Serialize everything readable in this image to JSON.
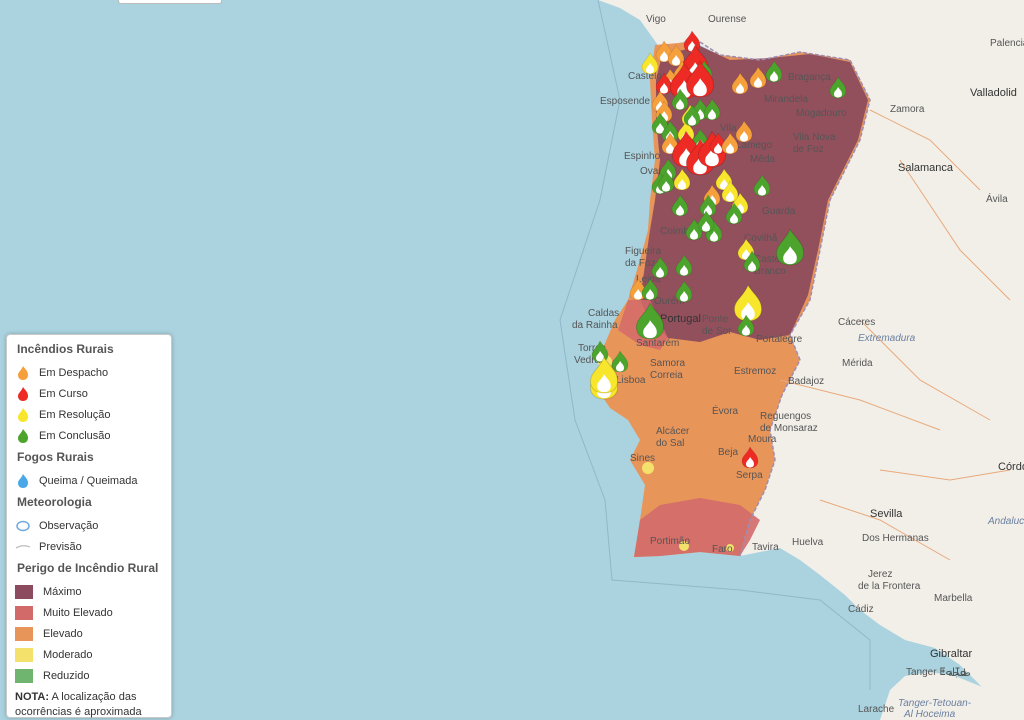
{
  "colors": {
    "sea": "#aad3df",
    "land": "#f2efe9",
    "danger_max": "#8b4a5e",
    "danger_very_high": "#d36a6a",
    "danger_high": "#e8955a",
    "danger_moderate": "#f3e16b",
    "danger_low": "#6fb56f",
    "fire_dispatch": "#f6a03c",
    "fire_ongoing": "#ee2a24",
    "fire_resolution": "#f7e62b",
    "fire_conclusion": "#4ca42c",
    "burn": "#4aa8e8"
  },
  "places": [
    {
      "name": "Vigo",
      "cls": ""
    },
    {
      "name": "Ourense",
      "cls": ""
    },
    {
      "name": "Palencia",
      "cls": ""
    },
    {
      "name": "Valladolid",
      "cls": "big"
    },
    {
      "name": "Zamora",
      "cls": ""
    },
    {
      "name": "Bragança",
      "cls": ""
    },
    {
      "name": "Mirandela",
      "cls": ""
    },
    {
      "name": "Mogadouro",
      "cls": ""
    },
    {
      "name": "Esposende",
      "cls": ""
    },
    {
      "name": "Castelo",
      "cls": ""
    },
    {
      "name": "Vila",
      "cls": ""
    },
    {
      "name": "Lamego",
      "cls": ""
    },
    {
      "name": "Vila Nova",
      "cls": ""
    },
    {
      "name": "de Foz",
      "cls": ""
    },
    {
      "name": "Salamanca",
      "cls": "big"
    },
    {
      "name": "Espinho",
      "cls": ""
    },
    {
      "name": "Ovar",
      "cls": ""
    },
    {
      "name": "Mêda",
      "cls": ""
    },
    {
      "name": "Ávila",
      "cls": ""
    },
    {
      "name": "Guarda",
      "cls": ""
    },
    {
      "name": "Coimbra",
      "cls": ""
    },
    {
      "name": "Figueira",
      "cls": ""
    },
    {
      "name": "da Foz",
      "cls": ""
    },
    {
      "name": "Covilhã",
      "cls": ""
    },
    {
      "name": "Castelo",
      "cls": ""
    },
    {
      "name": "Branco",
      "cls": ""
    },
    {
      "name": "Leiria",
      "cls": ""
    },
    {
      "name": "Ourém",
      "cls": ""
    },
    {
      "name": "Caldas",
      "cls": ""
    },
    {
      "name": "da Rainha",
      "cls": ""
    },
    {
      "name": "Portugal",
      "cls": "big"
    },
    {
      "name": "Ponte",
      "cls": ""
    },
    {
      "name": "de Sor",
      "cls": ""
    },
    {
      "name": "Cáceres",
      "cls": ""
    },
    {
      "name": "Portalegre",
      "cls": ""
    },
    {
      "name": "Extremadura",
      "cls": "it"
    },
    {
      "name": "Santarém",
      "cls": ""
    },
    {
      "name": "Torres",
      "cls": ""
    },
    {
      "name": "Vedras",
      "cls": ""
    },
    {
      "name": "Mérida",
      "cls": ""
    },
    {
      "name": "Samora",
      "cls": ""
    },
    {
      "name": "Correia",
      "cls": ""
    },
    {
      "name": "Estremoz",
      "cls": ""
    },
    {
      "name": "Lisboa",
      "cls": ""
    },
    {
      "name": "Badajoz",
      "cls": ""
    },
    {
      "name": "Évora",
      "cls": ""
    },
    {
      "name": "Reguengos",
      "cls": ""
    },
    {
      "name": "de Monsaraz",
      "cls": ""
    },
    {
      "name": "Alcácer",
      "cls": ""
    },
    {
      "name": "do Sal",
      "cls": ""
    },
    {
      "name": "Moura",
      "cls": ""
    },
    {
      "name": "Sines",
      "cls": ""
    },
    {
      "name": "Beja",
      "cls": ""
    },
    {
      "name": "Serpa",
      "cls": ""
    },
    {
      "name": "Córdoba",
      "cls": "big"
    },
    {
      "name": "Andalucía",
      "cls": "it"
    },
    {
      "name": "Sevilla",
      "cls": "big"
    },
    {
      "name": "Portimão",
      "cls": ""
    },
    {
      "name": "Faro",
      "cls": ""
    },
    {
      "name": "Tavira",
      "cls": ""
    },
    {
      "name": "Huelva",
      "cls": ""
    },
    {
      "name": "Dos Hermanas",
      "cls": ""
    },
    {
      "name": "Jerez",
      "cls": ""
    },
    {
      "name": "de la Frontera",
      "cls": ""
    },
    {
      "name": "Cádiz",
      "cls": ""
    },
    {
      "name": "Marbella",
      "cls": ""
    },
    {
      "name": "Gibraltar",
      "cls": "big"
    },
    {
      "name": "Tanger ⵟⴰⵏⵊⴰ",
      "cls": ""
    },
    {
      "name": "طنجة",
      "cls": ""
    },
    {
      "name": "Tanger-Tetouan-",
      "cls": "it"
    },
    {
      "name": "Al Hoceima",
      "cls": "it"
    },
    {
      "name": "Larache",
      "cls": ""
    }
  ],
  "fires": [
    {
      "s": "ongoing",
      "big": false
    },
    {
      "s": "dispatch",
      "big": false
    },
    {
      "s": "dispatch",
      "big": false
    },
    {
      "s": "ongoing",
      "big": true
    },
    {
      "s": "resolution",
      "big": false
    },
    {
      "s": "dispatch",
      "big": false
    },
    {
      "s": "dispatch",
      "big": false
    },
    {
      "s": "conclusion",
      "big": false
    },
    {
      "s": "ongoing",
      "big": false
    },
    {
      "s": "ongoing",
      "big": true
    },
    {
      "s": "ongoing",
      "big": true
    },
    {
      "s": "dispatch",
      "big": false
    },
    {
      "s": "dispatch",
      "big": false
    },
    {
      "s": "conclusion",
      "big": false
    },
    {
      "s": "conclusion",
      "big": false
    },
    {
      "s": "dispatch",
      "big": false
    },
    {
      "s": "conclusion",
      "big": false
    },
    {
      "s": "dispatch",
      "big": false
    },
    {
      "s": "resolution",
      "big": false
    },
    {
      "s": "conclusion",
      "big": false
    },
    {
      "s": "conclusion",
      "big": false
    },
    {
      "s": "conclusion",
      "big": false
    },
    {
      "s": "conclusion",
      "big": false
    },
    {
      "s": "resolution",
      "big": false
    },
    {
      "s": "dispatch",
      "big": false
    },
    {
      "s": "conclusion",
      "big": false
    },
    {
      "s": "dispatch",
      "big": false
    },
    {
      "s": "ongoing",
      "big": true
    },
    {
      "s": "ongoing",
      "big": true
    },
    {
      "s": "ongoing",
      "big": true
    },
    {
      "s": "ongoing",
      "big": false
    },
    {
      "s": "dispatch",
      "big": false
    },
    {
      "s": "conclusion",
      "big": false
    },
    {
      "s": "resolution",
      "big": false
    },
    {
      "s": "conclusion",
      "big": false
    },
    {
      "s": "resolution",
      "big": false
    },
    {
      "s": "resolution",
      "big": false
    },
    {
      "s": "dispatch",
      "big": false
    },
    {
      "s": "resolution",
      "big": false
    },
    {
      "s": "conclusion",
      "big": false
    },
    {
      "s": "conclusion",
      "big": false
    },
    {
      "s": "conclusion",
      "big": false
    },
    {
      "s": "conclusion",
      "big": false
    },
    {
      "s": "conclusion",
      "big": false
    },
    {
      "s": "conclusion",
      "big": false
    },
    {
      "s": "resolution",
      "big": false
    },
    {
      "s": "conclusion",
      "big": true
    },
    {
      "s": "conclusion",
      "big": false
    },
    {
      "s": "conclusion",
      "big": false
    },
    {
      "s": "dispatch",
      "big": false
    },
    {
      "s": "conclusion",
      "big": false
    },
    {
      "s": "conclusion",
      "big": false
    },
    {
      "s": "resolution",
      "big": true
    },
    {
      "s": "conclusion",
      "big": true
    },
    {
      "s": "conclusion",
      "big": false
    },
    {
      "s": "conclusion",
      "big": false
    },
    {
      "s": "conclusion",
      "big": false
    },
    {
      "s": "resolution",
      "big": true
    },
    {
      "s": "ongoing",
      "big": false
    },
    {
      "s": "conclusion",
      "big": false
    },
    {
      "s": "conclusion",
      "big": false
    },
    {
      "s": "conclusion",
      "big": false
    },
    {
      "s": "conclusion",
      "big": false
    },
    {
      "s": "resolution",
      "big": true
    }
  ],
  "legend": {
    "rural_fires_title": "Incêndios Rurais",
    "dispatch": "Em Despacho",
    "ongoing": "Em Curso",
    "resolution": "Em Resolução",
    "conclusion": "Em Conclusão",
    "rural_burns_title": "Fogos Rurais",
    "burn": "Queima / Queimada",
    "weather_title": "Meteorologia",
    "observation": "Observação",
    "forecast": "Previsão",
    "danger_title": "Perigo de Incêndio Rural",
    "max": "Máximo",
    "very_high": "Muito Elevado",
    "high": "Elevado",
    "moderate": "Moderado",
    "low": "Reduzido",
    "note_label": "NOTA:",
    "note_text": " A localização das ocorrências é aproximada"
  }
}
